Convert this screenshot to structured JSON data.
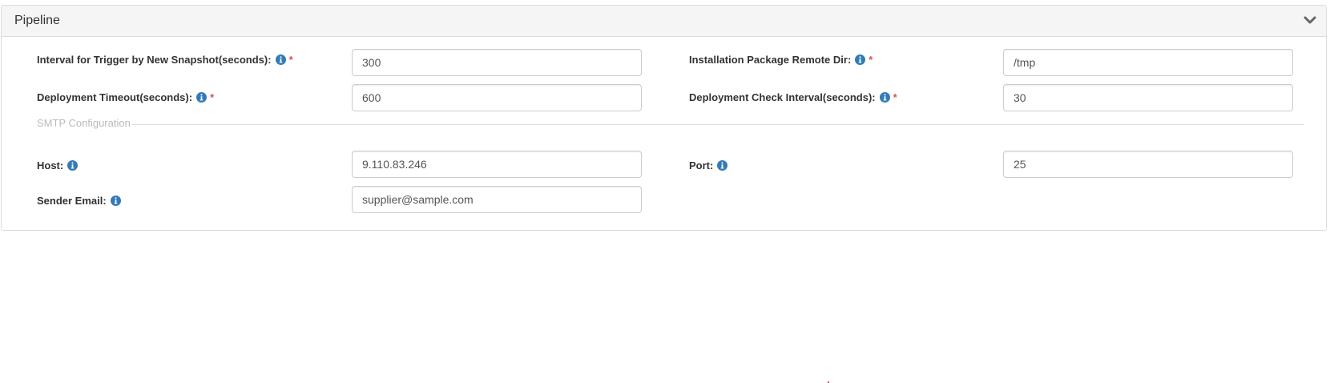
{
  "panel": {
    "title": "Pipeline",
    "toggle_icon": "chevron-down-icon"
  },
  "fields": {
    "trigger_interval": {
      "label": "Interval for Trigger by New Snapshot(seconds):",
      "value": "300",
      "required": true
    },
    "remote_dir": {
      "label": "Installation Package Remote Dir:",
      "value": "/tmp",
      "required": true
    },
    "deploy_timeout": {
      "label": "Deployment Timeout(seconds):",
      "value": "600",
      "required": true
    },
    "check_interval": {
      "label": "Deployment Check Interval(seconds):",
      "value": "30",
      "required": true
    },
    "host": {
      "label": "Host:",
      "value": "9.110.83.246",
      "required": false
    },
    "port": {
      "label": "Port:",
      "value": "25",
      "required": false
    },
    "sender_email": {
      "label": "Sender Email:",
      "value": "supplier@sample.com",
      "required": false
    }
  },
  "smtp_section": {
    "legend": "SMTP Configuration"
  },
  "required_marker": "*",
  "colors": {
    "info_icon": "#337ab7",
    "required": "#d9534f",
    "heading_bg": "#f5f5f5"
  }
}
